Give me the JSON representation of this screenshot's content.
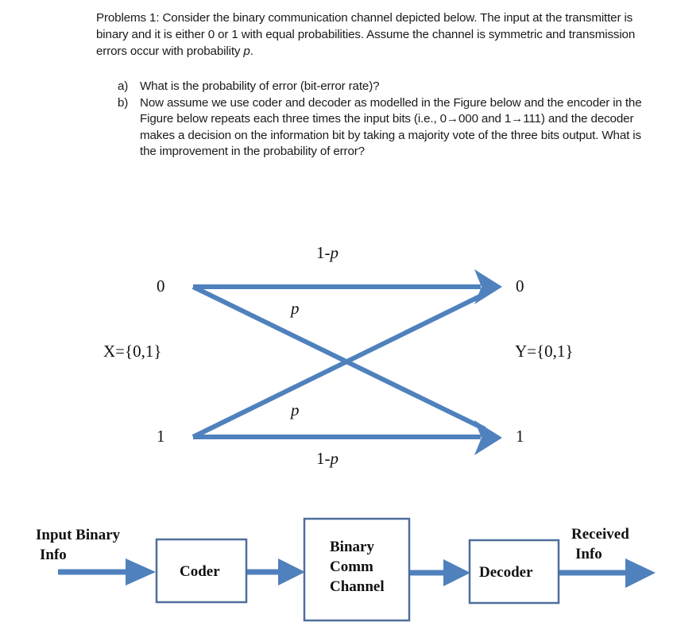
{
  "problem": {
    "intro_text": "Problems 1: Consider the binary communication channel depicted below.  The input at the transmitter is binary and it is either 0 or 1 with equal probabilities. Assume the channel is symmetric and transmission errors occur with probability",
    "intro_var": "p",
    "intro_end": ".",
    "questions": [
      {
        "label": "a)",
        "text": "What is the probability of error (bit-error rate)?"
      },
      {
        "label": "b)",
        "text": "Now assume we use coder and decoder as modelled in the Figure below and the encoder in the Figure below repeats each three times the input bits (i.e., 0→000 and 1→111) and the decoder makes a decision on the information bit by taking a majority vote of the three bits output. What is the improvement in the probability of error?"
      }
    ]
  },
  "channel_diagram": {
    "accent_color": "#4F81BD",
    "input_0": "0",
    "input_1": "1",
    "output_0": "0",
    "output_1": "1",
    "input_set": "X={0,1}",
    "output_set": "Y={0,1}",
    "top_prob_prefix": "1-",
    "top_prob_var": "p",
    "bottom_prob_prefix": "1-",
    "bottom_prob_var": "p",
    "cross_prob_upper": "p",
    "cross_prob_lower": "p"
  },
  "block_diagram": {
    "input_label_line1": "Input Binary",
    "input_label_line2": "Info",
    "coder_label": "Coder",
    "channel_label_line1": "Binary",
    "channel_label_line2": "Comm",
    "channel_label_line3": "Channel",
    "decoder_label": "Decoder",
    "output_label_line1": "Received",
    "output_label_line2": "Info"
  }
}
